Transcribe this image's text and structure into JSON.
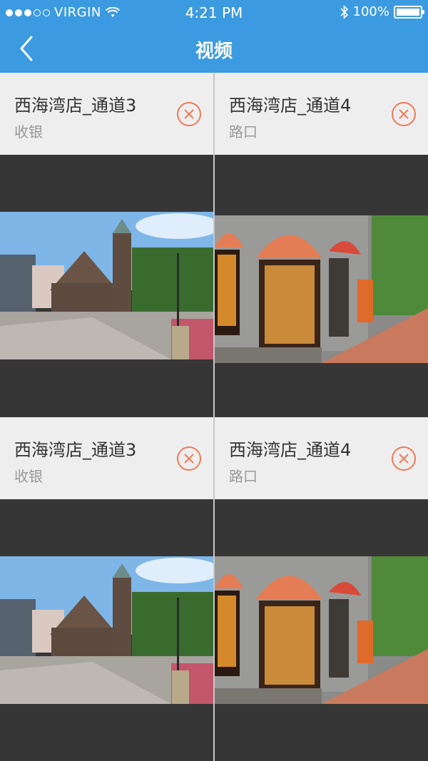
{
  "status_bar": {
    "carrier": "VIRGIN",
    "time": "4:21 PM",
    "battery": "100%",
    "signal_icon": "signal-dots-icon",
    "wifi_icon": "wifi-icon",
    "bluetooth_icon": "bluetooth-icon"
  },
  "nav": {
    "title": "视频",
    "back_icon": "chevron-left-icon"
  },
  "channels": [
    {
      "name": "西海湾店_通道3",
      "subtitle": "收银",
      "thumbnail": "church-plaza"
    },
    {
      "name": "西海湾店_通道4",
      "subtitle": "路口",
      "thumbnail": "storefront-street"
    },
    {
      "name": "西海湾店_通道3",
      "subtitle": "收银",
      "thumbnail": "church-plaza"
    },
    {
      "name": "西海湾店_通道4",
      "subtitle": "路口",
      "thumbnail": "storefront-street"
    }
  ],
  "colors": {
    "header_blue": "#3c9be0",
    "close_orange": "#f07a57",
    "video_bg": "#363636",
    "card_bg": "#eeeeee"
  }
}
